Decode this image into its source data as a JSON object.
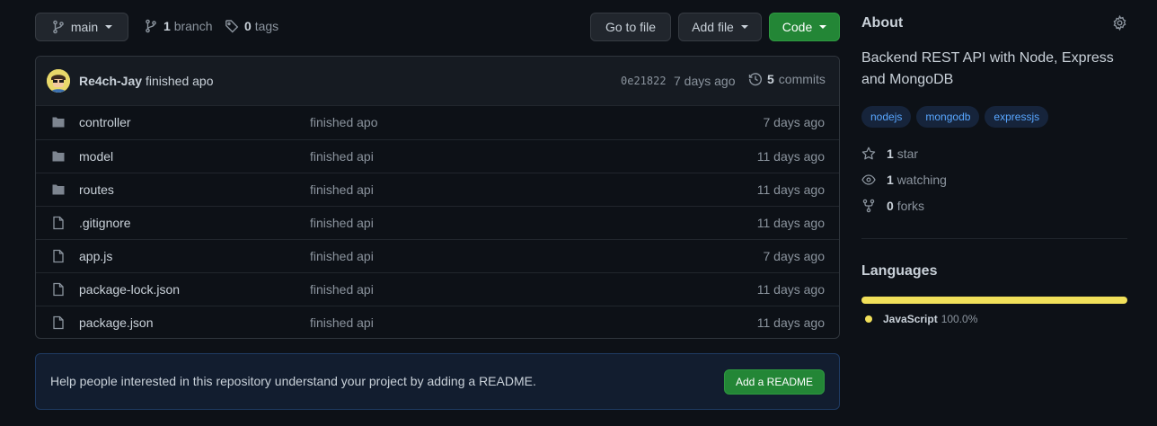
{
  "toolbar": {
    "branch_label": "main",
    "branch_count": "1",
    "branch_word": "branch",
    "tag_count": "0",
    "tag_word": "tags",
    "go_to_file": "Go to file",
    "add_file": "Add file",
    "code": "Code"
  },
  "commit": {
    "author": "Re4ch-Jay",
    "message": "finished apo",
    "sha": "0e21822",
    "age": "7 days ago",
    "count": "5",
    "count_word": "commits"
  },
  "files": [
    {
      "name": "controller",
      "type": "folder",
      "message": "finished apo",
      "age": "7 days ago"
    },
    {
      "name": "model",
      "type": "folder",
      "message": "finished api",
      "age": "11 days ago"
    },
    {
      "name": "routes",
      "type": "folder",
      "message": "finished api",
      "age": "11 days ago"
    },
    {
      "name": ".gitignore",
      "type": "file",
      "message": "finished api",
      "age": "11 days ago"
    },
    {
      "name": "app.js",
      "type": "file",
      "message": "finished api",
      "age": "7 days ago"
    },
    {
      "name": "package-lock.json",
      "type": "file",
      "message": "finished api",
      "age": "11 days ago"
    },
    {
      "name": "package.json",
      "type": "file",
      "message": "finished api",
      "age": "11 days ago"
    }
  ],
  "readme_banner": {
    "text": "Help people interested in this repository understand your project by adding a README.",
    "button": "Add a README"
  },
  "about": {
    "title": "About",
    "description": "Backend REST API with Node, Express and MongoDB",
    "topics": [
      "nodejs",
      "mongodb",
      "expressjs"
    ],
    "stars": {
      "count": "1",
      "label": "star"
    },
    "watching": {
      "count": "1",
      "label": "watching"
    },
    "forks": {
      "count": "0",
      "label": "forks"
    }
  },
  "languages": {
    "title": "Languages",
    "items": [
      {
        "name": "JavaScript",
        "percent": "100.0%",
        "fraction": 1.0,
        "color": "#f1e05a"
      }
    ]
  },
  "colors": {
    "background": "#0d1117",
    "primary_button": "#238636",
    "link": "#58a6ff",
    "muted_text": "#8b949e"
  }
}
